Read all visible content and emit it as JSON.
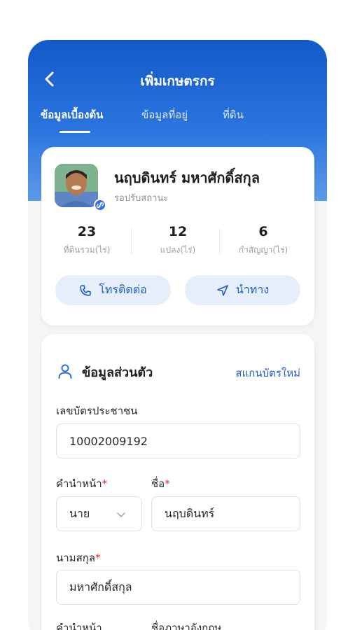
{
  "header": {
    "title": "เพิ่มเกษตรกร",
    "tabs": [
      {
        "label": "ข้อมูลเบื้องต้น",
        "active": true
      },
      {
        "label": "ข้อมูลที่อยู่",
        "active": false
      },
      {
        "label": "ที่ดิน",
        "active": false
      }
    ]
  },
  "profile": {
    "name": "นฤบดินทร์ มหาศักดิ์สกุล",
    "status": "รอปรับสถานะ",
    "stats": [
      {
        "value": "23",
        "label": "ที่ดินรวม(ไร่)"
      },
      {
        "value": "12",
        "label": "แปลง(ไร่)"
      },
      {
        "value": "6",
        "label": "กำสัญญา(ไร่)"
      }
    ],
    "call_label": "โทรติดต่อ",
    "navigate_label": "นำทาง"
  },
  "personal": {
    "section_title": "ข้อมูลส่วนตัว",
    "scan_label": "สแกนบัตรใหม่",
    "id_label": "เลขบัตรประชาชน",
    "id_value": "10002009192",
    "prefix_label": "คำนำหน้า",
    "prefix_value": "นาย",
    "firstname_label": "ชื่อ",
    "firstname_value": "นฤบดินทร์",
    "lastname_label": "นามสกุล",
    "lastname_value": "มหาศักดิ์สกุล",
    "prefix_en_label": "คำนำหน้า",
    "firstname_en_label": "ชื่อภาษาอังกฤษ",
    "required_mark": "*"
  },
  "colors": {
    "brand": "#1359c9",
    "accent_text": "#1f5ec8",
    "required": "#d93232"
  }
}
